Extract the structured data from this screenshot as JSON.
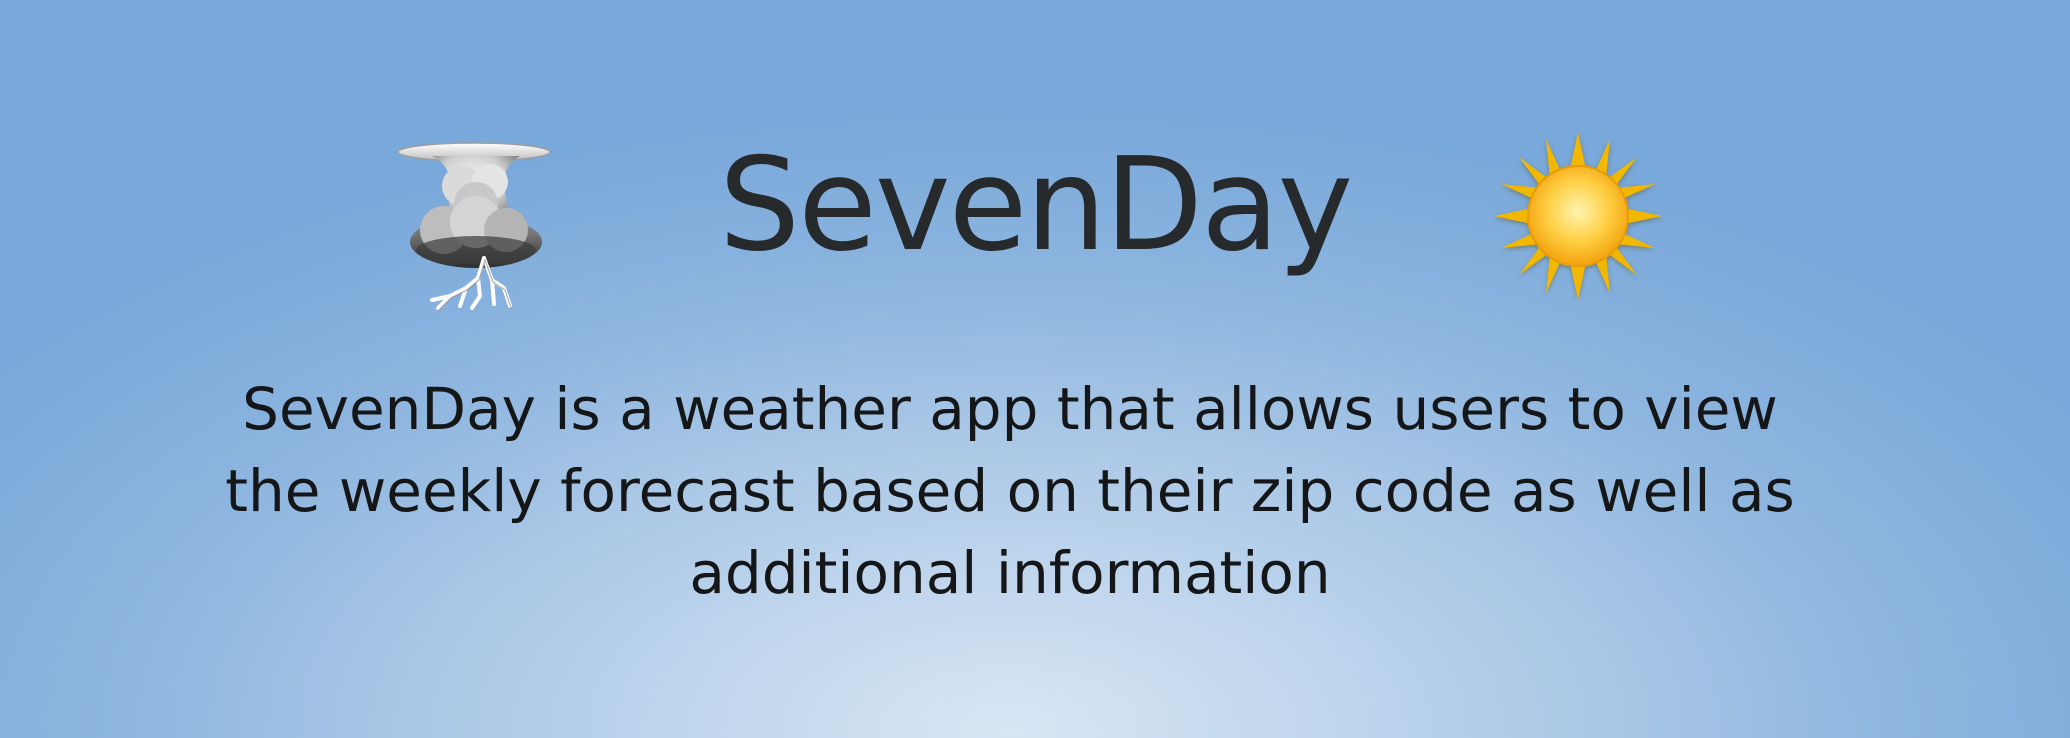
{
  "app": {
    "title": "SevenDay",
    "description_lines": [
      "SevenDay is a weather app that allows users to view",
      "the weekly forecast based on their zip code as well as",
      "additional information"
    ]
  },
  "icons": {
    "left": "thunderstorm-icon",
    "right": "sun-icon"
  },
  "colors": {
    "background_center": "#d7e6f4",
    "background_edge": "#79a8da",
    "title_text": "#262a2c",
    "body_text": "#141618",
    "sun_core": "#ffc93a",
    "sun_ray": "#f2b705",
    "cloud": "#c9c9c9"
  }
}
